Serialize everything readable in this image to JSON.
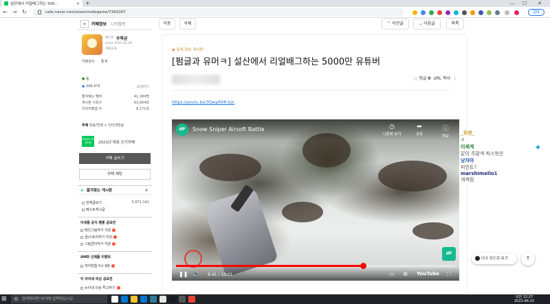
{
  "browser": {
    "tab_title": "설산에서 리얼배그하는 500...",
    "url": "cafe.naver.com/steamindiegame/7341007",
    "update_label": "업데"
  },
  "sidebar": {
    "tabs": [
      "카페정보",
      "나의활동"
    ],
    "manager_label": "매니저",
    "manager_name": "우왁굳",
    "since": "since 2015.02.26.",
    "intro_link": "카페소개",
    "mgmt_links": [
      "카페관리",
      "통계"
    ],
    "grade": "숲",
    "members": "398,976",
    "invite": "초대하기",
    "stats": [
      {
        "label": "즐겨찾는 멤버",
        "value": "41,184명"
      },
      {
        "label": "게시판 구독수",
        "value": "63,904회"
      },
      {
        "label": "우리카페앱 수",
        "value": "6,171회"
      }
    ],
    "topic_label": "주제",
    "topic_value": "방송/연예 > 인터넷방송",
    "badge_text": "NAVER 대표카페",
    "badge_caption": "2021년 대표 인기카페",
    "write_button": "카페 글쓰기",
    "chat_button": "카페 채팅",
    "fav_board_title": "즐겨찾는 게시판",
    "fav_items": [
      {
        "label": "전체글보기",
        "value": "5,671,141"
      },
      {
        "label": "베스트게시글",
        "value": ""
      }
    ],
    "sections": [
      {
        "title": "이세돌 공식 팬툰 공모전",
        "items": [
          "메인그림작가 지원",
          "글/스토리작가 지원",
          "그림콘티작가 지원"
        ]
      },
      {
        "title": "AMD 신제품 이벤트",
        "items": [
          "게이밍칩 5시 8분"
        ]
      },
      {
        "title": "이 아이네 의상 공모전",
        "items": [
          "뉴이네 의상 투고하기"
        ]
      }
    ]
  },
  "article": {
    "top_buttons": [
      "이동",
      "삭제",
      "이전글",
      "다음글",
      "목록"
    ],
    "board_label": "유머,정보 게시판",
    "title": "[펌글과 유머ㅋ] 설산에서 리얼배그하는 5000만 유튜버",
    "comment_label": "댓글",
    "comment_count": "0",
    "copy_url": "URL 복사",
    "link": "https://youtu.be/3QwpRXR-IUc"
  },
  "video": {
    "channel_logo": "dP",
    "title": "Snow Sniper Airsoft Battle",
    "later_label": "나중에 보기",
    "share_label": "공유",
    "info_label": "정보",
    "current_time": "6:41",
    "duration": "10:01",
    "progress": 0.67,
    "brand": "YouTube",
    "accent": "#ff0000"
  },
  "chat": [
    {
      "name": "_호밴_",
      "msg": "ㅈ",
      "color": "#c9a227"
    },
    {
      "name": "리세계",
      "msg": "같이 주황색 파스벗은",
      "color": "#2e7d32"
    },
    {
      "name": "낭자아",
      "msg": "피인트?",
      "color": "#1e4ea8"
    },
    {
      "name": "marshimello1",
      "msg": "개색점",
      "color": "#1e2a78"
    }
  ],
  "floating": {
    "dark_mode": "다크 모드로 보기",
    "top": "↑"
  },
  "taskbar": {
    "search_placeholder": "검색하려면 여기에 입력하십시오",
    "time": "오전 12:27",
    "date": "2022-06-22"
  }
}
